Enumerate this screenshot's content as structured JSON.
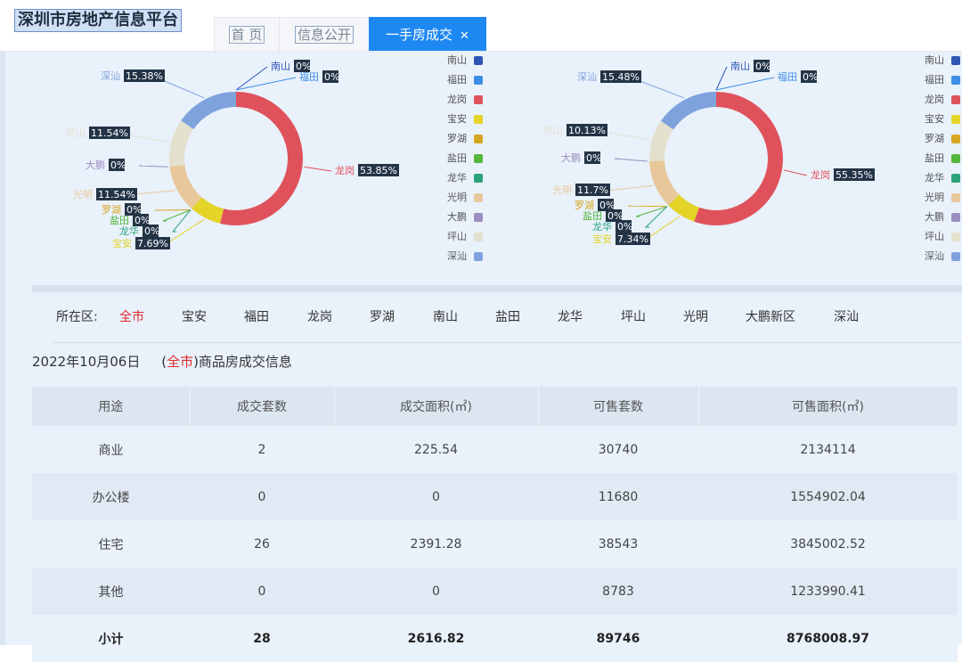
{
  "app": {
    "title": "深圳市房地产信息平台",
    "tabs": [
      {
        "label": "首 页",
        "active": false
      },
      {
        "label": "信息公开",
        "active": false
      },
      {
        "label": "一手房成交",
        "active": true,
        "close_icon": "close-icon"
      }
    ]
  },
  "legend": [
    "南山",
    "福田",
    "龙岗",
    "宝安",
    "罗湖",
    "盐田",
    "龙华",
    "光明",
    "大鹏",
    "坪山",
    "深汕"
  ],
  "colors": {
    "南山": "#2f55b5",
    "福田": "#3d8ee6",
    "龙岗": "#e0525b",
    "宝安": "#e3d427",
    "罗湖": "#d7a620",
    "盐田": "#55b63d",
    "龙华": "#2aa37a",
    "光明": "#e8c89a",
    "大鹏": "#9b8dc0",
    "坪山": "#e3e1ce",
    "深汕": "#7ea2dc"
  },
  "chart_data": [
    {
      "type": "pie",
      "categories": [
        "南山",
        "福田",
        "龙岗",
        "宝安",
        "罗湖",
        "盐田",
        "龙华",
        "光明",
        "大鹏",
        "坪山",
        "深汕"
      ],
      "values": [
        0,
        0,
        53.85,
        7.69,
        0,
        0,
        0,
        11.54,
        0,
        11.54,
        15.38
      ],
      "labels": [
        "0%",
        "0%",
        "53.85%",
        "7.69%",
        "0%",
        "0%",
        "0%",
        "11.54%",
        "0%",
        "11.54%",
        "15.38%"
      ],
      "legend_placement": "right",
      "donut": true
    },
    {
      "type": "pie",
      "categories": [
        "南山",
        "福田",
        "龙岗",
        "宝安",
        "罗湖",
        "盐田",
        "龙华",
        "光明",
        "大鹏",
        "坪山",
        "深汕"
      ],
      "values": [
        0,
        0,
        55.35,
        7.34,
        0,
        0,
        0,
        11.7,
        0,
        10.13,
        15.48
      ],
      "labels": [
        "0%",
        "0%",
        "55.35%",
        "7.34%",
        "0%",
        "0%",
        "0%",
        "11.7%",
        "0%",
        "10.13%",
        "15.48%"
      ],
      "legend_placement": "right",
      "donut": true
    }
  ],
  "filter": {
    "label": "所在区:",
    "districts": [
      "全市",
      "宝安",
      "福田",
      "龙岗",
      "罗湖",
      "南山",
      "盐田",
      "龙华",
      "坪山",
      "光明",
      "大鹏新区",
      "深汕"
    ],
    "active": "全市"
  },
  "summary": {
    "date": "2022年10月06日",
    "open_paren": "(",
    "region": "全市",
    "suffix": ")商品房成交信息"
  },
  "table": {
    "headers": [
      "用途",
      "成交套数",
      "成交面积(㎡)",
      "可售套数",
      "可售面积(㎡)"
    ],
    "rows": [
      [
        "商业",
        "2",
        "225.54",
        "30740",
        "2134114"
      ],
      [
        "办公楼",
        "0",
        "0",
        "11680",
        "1554902.04"
      ],
      [
        "住宅",
        "26",
        "2391.28",
        "38543",
        "3845002.52"
      ],
      [
        "其他",
        "0",
        "0",
        "8783",
        "1233990.41"
      ]
    ],
    "total": [
      "小计",
      "28",
      "2616.82",
      "89746",
      "8768008.97"
    ]
  }
}
